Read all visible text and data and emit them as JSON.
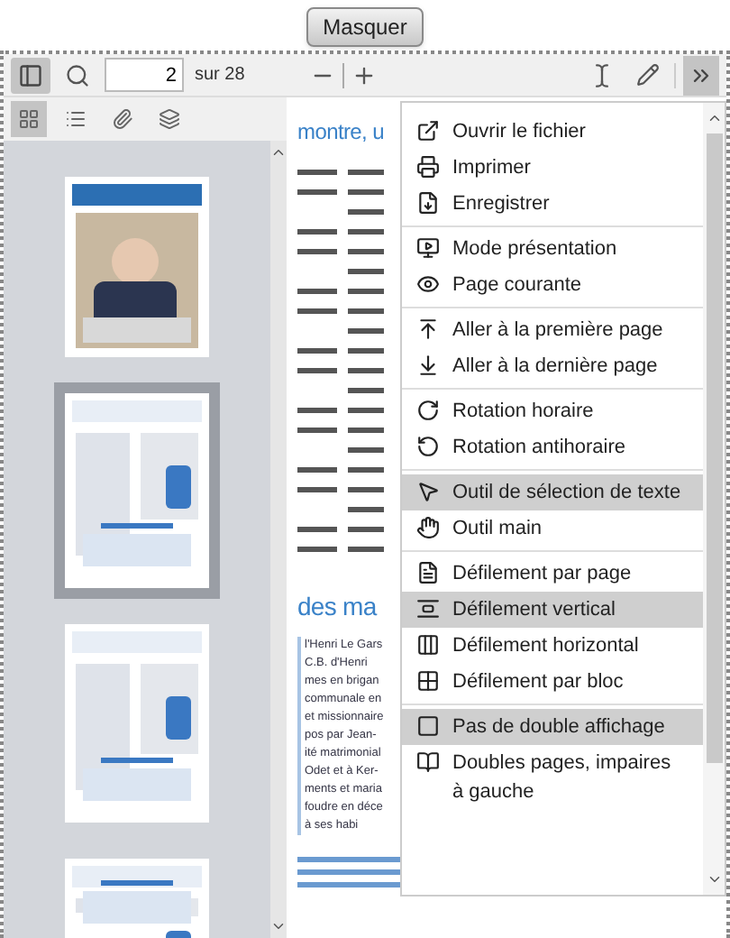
{
  "hide_button": "Masquer",
  "toolbar": {
    "sidebar_toggle": {
      "selected": true
    },
    "page_input": {
      "value": "2"
    },
    "page_count": "sur 28",
    "overflow_button": {
      "selected": true
    }
  },
  "sidebar": {
    "tabs": [
      {
        "selected": true
      },
      {
        "selected": false
      },
      {
        "selected": false
      },
      {
        "selected": false
      }
    ],
    "thumbnails": [
      {
        "selected": false
      },
      {
        "selected": true
      },
      {
        "selected": false
      },
      {
        "selected": false
      }
    ]
  },
  "document": {
    "heading_1": "montre, u",
    "heading_2": "des ma",
    "lines": [
      "l'Henri Le Gars",
      "C.B. d'Henri",
      "mes en brigan",
      "communale en",
      "et missionnaire",
      "pos par Jean-",
      "ité matrimonial",
      "Odet et à Ker-",
      "ments et maria",
      "foudre en déce",
      "à ses habi"
    ]
  },
  "menu": {
    "groups": [
      [
        {
          "label": "Ouvrir le fichier",
          "selected": false
        },
        {
          "label": "Imprimer",
          "selected": false
        },
        {
          "label": "Enregistrer",
          "selected": false
        }
      ],
      [
        {
          "label": "Mode présentation",
          "selected": false
        },
        {
          "label": "Page courante",
          "selected": false
        }
      ],
      [
        {
          "label": "Aller à la première page",
          "selected": false
        },
        {
          "label": "Aller à la dernière page",
          "selected": false
        }
      ],
      [
        {
          "label": "Rotation horaire",
          "selected": false
        },
        {
          "label": "Rotation antihoraire",
          "selected": false
        }
      ],
      [
        {
          "label": "Outil de sélection de texte",
          "selected": true
        },
        {
          "label": "Outil main",
          "selected": false
        }
      ],
      [
        {
          "label": "Défilement par page",
          "selected": false
        },
        {
          "label": "Défilement vertical",
          "selected": true
        },
        {
          "label": "Défilement horizontal",
          "selected": false
        },
        {
          "label": "Défilement par bloc",
          "selected": false
        }
      ],
      [
        {
          "label": "Pas de double affichage",
          "selected": true
        },
        {
          "label": "Doubles pages, impaires à gauche",
          "selected": false
        }
      ]
    ]
  }
}
